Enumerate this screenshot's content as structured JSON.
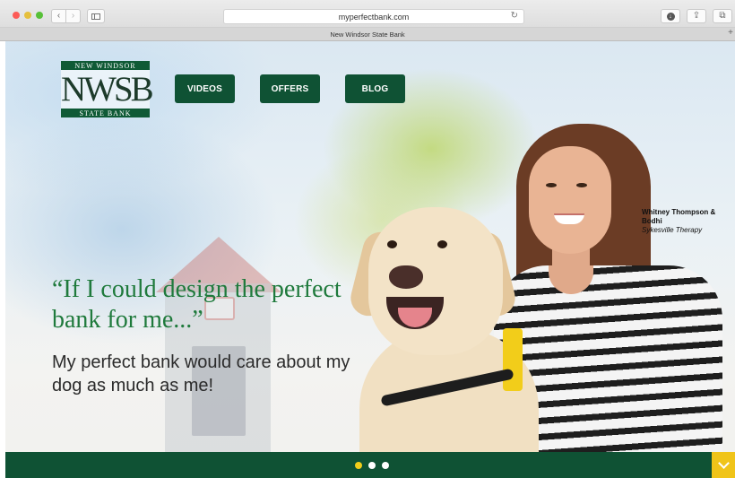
{
  "browser": {
    "url": "myperfectbank.com",
    "tab_title": "New Windsor State Bank",
    "back_glyph": "‹",
    "forward_glyph": "›",
    "reload_glyph": "↻",
    "share_glyph": "⇪",
    "tabs_glyph": "⧉",
    "download_glyph": "↓",
    "new_tab_glyph": "+"
  },
  "logo": {
    "top_text": "NEW WINDSOR",
    "mark": "NWSB",
    "bottom_text": "STATE BANK"
  },
  "nav": {
    "videos": "VIDEOS",
    "offers": "OFFERS",
    "blog": "BLOG"
  },
  "hero": {
    "quote": "“If I could design the perfect bank for me...”",
    "tagline": "My perfect bank would care about my dog as much as me!"
  },
  "caption": {
    "name": "Whitney Thompson & Bodhi",
    "company": "Sykesville Therapy"
  },
  "carousel": {
    "active_slide": 1,
    "total_slides": 3
  },
  "colors": {
    "brand_green": "#0f5234",
    "quote_green": "#1f7a3c",
    "accent_yellow": "#f2cd1a"
  },
  "icons": {
    "scroll": "chevron-down-icon"
  }
}
